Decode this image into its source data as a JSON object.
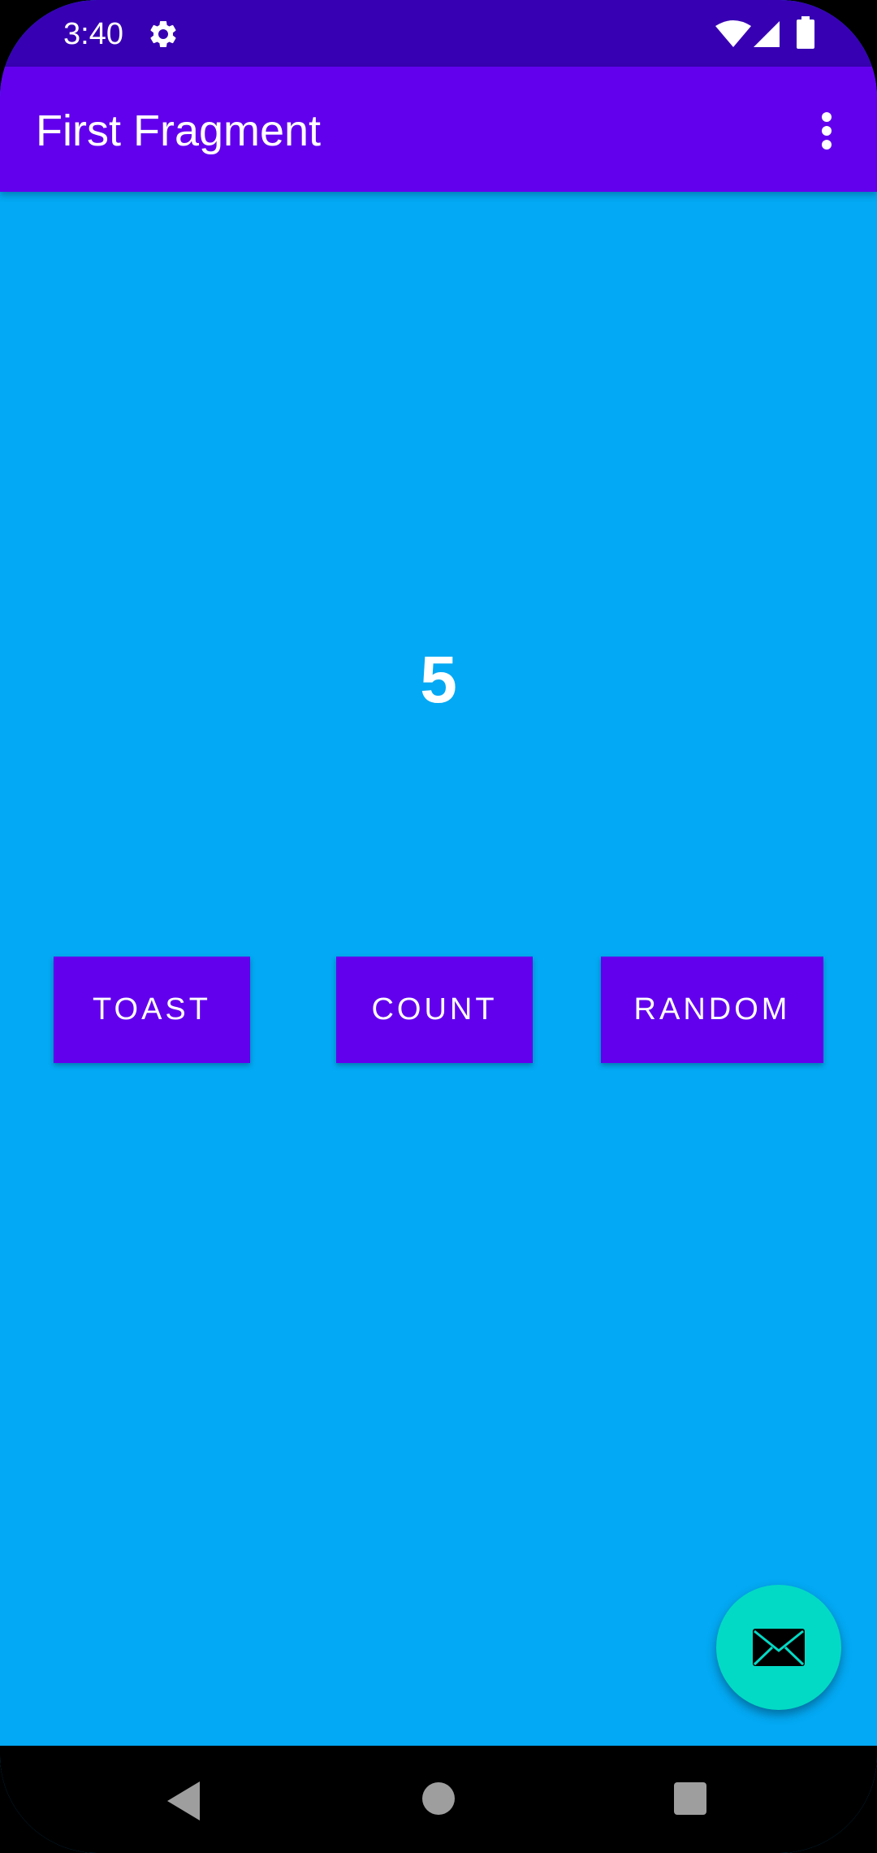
{
  "status_bar": {
    "time": "3:40",
    "icons": [
      "settings-icon",
      "wifi-icon",
      "signal-icon",
      "battery-icon"
    ]
  },
  "app_bar": {
    "title": "First Fragment",
    "overflow_icon": "more-vert-icon"
  },
  "main": {
    "count_value": "5",
    "buttons": [
      {
        "label": "TOAST"
      },
      {
        "label": "COUNT"
      },
      {
        "label": "RANDOM"
      }
    ]
  },
  "fab": {
    "icon": "email-icon"
  },
  "nav_bar": {
    "icons": [
      "back-icon",
      "home-icon",
      "recents-icon"
    ]
  },
  "colors": {
    "status_bar": "#3700b3",
    "primary": "#6200ee",
    "background": "#03a9f4",
    "fab": "#03dac5",
    "text_on_primary": "#ffffff"
  }
}
